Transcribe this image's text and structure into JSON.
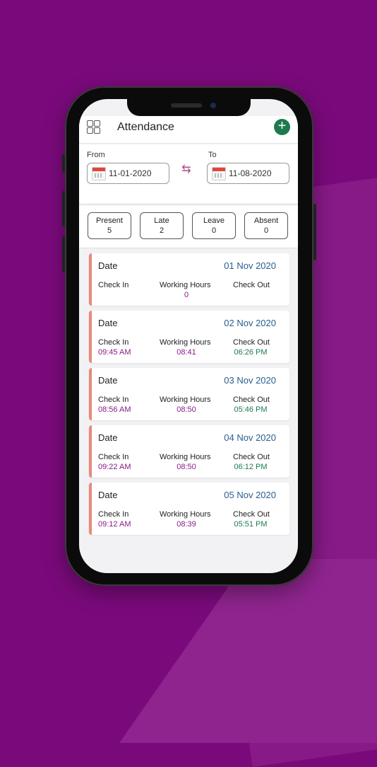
{
  "header": {
    "title": "Attendance"
  },
  "range": {
    "from_label": "From",
    "from_date": "11-01-2020",
    "to_label": "To",
    "to_date": "11-08-2020"
  },
  "stats": [
    {
      "label": "Present",
      "value": "5"
    },
    {
      "label": "Late",
      "value": "2"
    },
    {
      "label": "Leave",
      "value": "0"
    },
    {
      "label": "Absent",
      "value": "0"
    }
  ],
  "records": [
    {
      "date_label": "Date",
      "date": "01 Nov 2020",
      "check_in_label": "Check In",
      "check_in": "",
      "working_hours_label": "Working Hours",
      "working_hours": "0",
      "check_out_label": "Check Out",
      "check_out": ""
    },
    {
      "date_label": "Date",
      "date": "02 Nov 2020",
      "check_in_label": "Check In",
      "check_in": "09:45 AM",
      "working_hours_label": "Working Hours",
      "working_hours": "08:41",
      "check_out_label": "Check Out",
      "check_out": "06:26 PM"
    },
    {
      "date_label": "Date",
      "date": "03 Nov 2020",
      "check_in_label": "Check In",
      "check_in": "08:56 AM",
      "working_hours_label": "Working Hours",
      "working_hours": "08:50",
      "check_out_label": "Check Out",
      "check_out": "05:46 PM"
    },
    {
      "date_label": "Date",
      "date": "04 Nov 2020",
      "check_in_label": "Check In",
      "check_in": "09:22 AM",
      "working_hours_label": "Working Hours",
      "working_hours": "08:50",
      "check_out_label": "Check Out",
      "check_out": "06:12 PM"
    },
    {
      "date_label": "Date",
      "date": "05 Nov 2020",
      "check_in_label": "Check In",
      "check_in": "09:12 AM",
      "working_hours_label": "Working Hours",
      "working_hours": "08:39",
      "check_out_label": "Check Out",
      "check_out": "05:51 PM"
    }
  ],
  "icons": {
    "menu": "grid-icon",
    "add": "plus-icon",
    "calendar": "calendar-icon",
    "swap": "swap-arrows-icon"
  },
  "colors": {
    "background": "#7a0a7b",
    "accent_green": "#1e7a4e",
    "date_blue": "#2a5d8f",
    "value_purple": "#8a1a8a",
    "card_stripe": "#e8897a"
  }
}
